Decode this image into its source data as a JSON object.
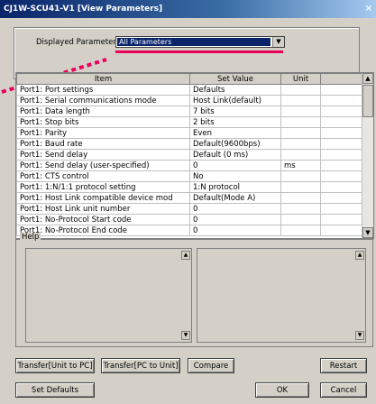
{
  "window": {
    "title": "CJ1W-SCU41-V1 [View Parameters]",
    "close_glyph": "×"
  },
  "param": {
    "label": "Displayed Parameter",
    "selected": "All Parameters"
  },
  "table": {
    "headers": [
      "Item",
      "Set Value",
      "Unit"
    ],
    "rows": [
      [
        "Port1: Port settings",
        "Defaults",
        ""
      ],
      [
        "Port1: Serial communications mode",
        "Host Link(default)",
        ""
      ],
      [
        "Port1: Data length",
        "7 bits",
        ""
      ],
      [
        "Port1: Stop bits",
        "2 bits",
        ""
      ],
      [
        "Port1: Parity",
        "Even",
        ""
      ],
      [
        "Port1: Baud rate",
        "Default(9600bps)",
        ""
      ],
      [
        "Port1: Send delay",
        "Default (0 ms)",
        ""
      ],
      [
        "Port1: Send delay (user-specified)",
        "0",
        "ms"
      ],
      [
        "Port1: CTS control",
        "No",
        ""
      ],
      [
        "Port1: 1:N/1:1 protocol setting",
        "1:N protocol",
        ""
      ],
      [
        "Port1: Host Link compatible device mod",
        "Default(Mode A)",
        ""
      ],
      [
        "Port1: Host Link unit number",
        "0",
        ""
      ],
      [
        "Port1: No-Protocol Start code",
        "0",
        ""
      ],
      [
        "Port1: No-Protocol End code",
        "0",
        ""
      ]
    ]
  },
  "help": {
    "label": "Help"
  },
  "buttons": {
    "transfer_unit_to_pc": "Transfer[Unit to PC]",
    "transfer_pc_to_unit": "Transfer[PC to Unit]",
    "compare": "Compare",
    "restart": "Restart",
    "set_defaults": "Set Defaults",
    "ok": "OK",
    "cancel": "Cancel"
  }
}
